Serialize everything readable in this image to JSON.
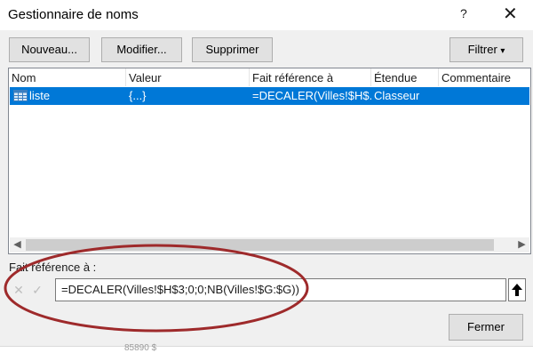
{
  "window": {
    "title": "Gestionnaire de noms",
    "help_label": "?",
    "close_label": "✕"
  },
  "toolbar": {
    "new_label": "Nouveau...",
    "edit_label": "Modifier...",
    "delete_label": "Supprimer",
    "filter_label": "Filtrer",
    "filter_icon": "▾"
  },
  "table": {
    "columns": [
      "Nom",
      "Valeur",
      "Fait référence à",
      "Étendue",
      "Commentaire"
    ],
    "rows": [
      {
        "name": "liste",
        "value": "{...}",
        "refers_to": "=DECALER(Villes!$H$...",
        "scope": "Classeur",
        "comment": "",
        "icon": "table-name-icon"
      }
    ]
  },
  "scrollbar": {
    "left_arrow": "◀",
    "right_arrow": "▶"
  },
  "refers_to_section": {
    "label": "Fait référence à :",
    "formula": "=DECALER(Villes!$H$3;0;0;NB(Villes!$G:$G))",
    "cancel_icon": "✕",
    "confirm_icon": "✓",
    "collapse_icon": "arrow-up-icon"
  },
  "footer": {
    "close_label": "Fermer"
  },
  "background_text": "85890  $",
  "colors": {
    "selection": "#0078d7",
    "annotation": "#9e2a2b",
    "dialog_bg": "#f0f0f0"
  }
}
